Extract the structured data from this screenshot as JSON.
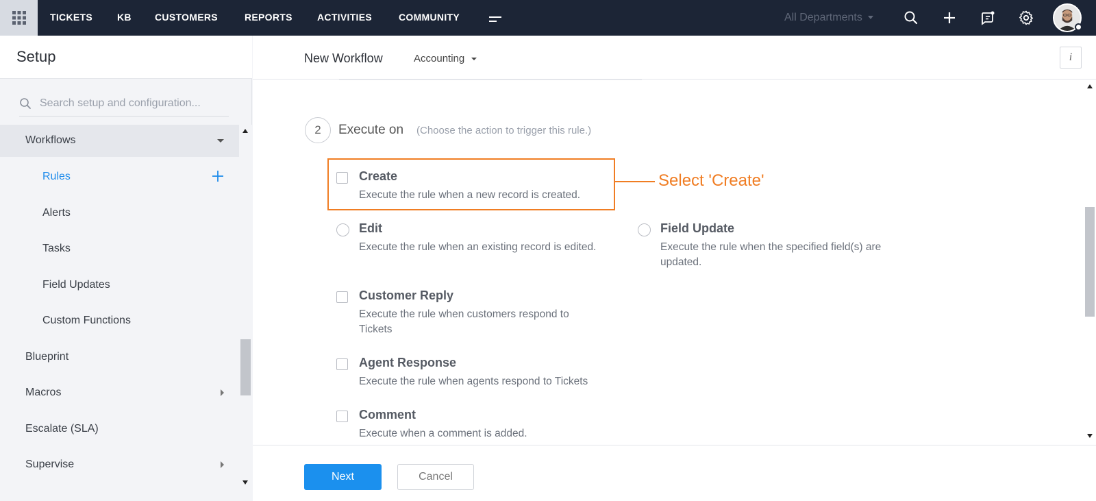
{
  "topnav": {
    "apps_icon": "grid-icon",
    "links": [
      "TICKETS",
      "KB",
      "CUSTOMERS",
      "REPORTS",
      "ACTIVITIES",
      "COMMUNITY"
    ],
    "more_icon": "menu-icon",
    "department": "All Departments",
    "icons": [
      "search-icon",
      "plus-icon",
      "chat-icon",
      "gear-icon"
    ]
  },
  "sidebar": {
    "title": "Setup",
    "search_placeholder": "Search setup and configuration...",
    "items": [
      {
        "label": "Workflows",
        "level": "top",
        "state": "expanded"
      },
      {
        "label": "Rules",
        "level": "sub",
        "state": "selected"
      },
      {
        "label": "Alerts",
        "level": "sub"
      },
      {
        "label": "Tasks",
        "level": "sub"
      },
      {
        "label": "Field Updates",
        "level": "sub"
      },
      {
        "label": "Custom Functions",
        "level": "sub"
      },
      {
        "label": "Blueprint",
        "level": "top"
      },
      {
        "label": "Macros",
        "level": "top",
        "state": "collapsed"
      },
      {
        "label": "Escalate (SLA)",
        "level": "top"
      },
      {
        "label": "Supervise",
        "level": "top",
        "state": "collapsed"
      }
    ]
  },
  "header": {
    "title": "New Workflow",
    "department": "Accounting",
    "info_label": "i"
  },
  "step": {
    "number": "2",
    "title": "Execute on",
    "hint": "(Choose the action to trigger this rule.)"
  },
  "options": {
    "create": {
      "title": "Create",
      "desc": "Execute the rule when a new record is created."
    },
    "edit": {
      "title": "Edit",
      "desc": "Execute the rule when an existing record is edited."
    },
    "field_update": {
      "title": "Field Update",
      "desc": "Execute the rule when the specified field(s) are updated."
    },
    "customer_reply": {
      "title": "Customer Reply",
      "desc": "Execute the rule when customers respond to Tickets"
    },
    "agent_response": {
      "title": "Agent Response",
      "desc": "Execute the rule when agents respond to Tickets"
    },
    "comment": {
      "title": "Comment",
      "desc": "Execute when a comment is added."
    }
  },
  "callout": {
    "text": "Select 'Create'",
    "color": "#f07d23"
  },
  "footer": {
    "next_label": "Next",
    "cancel_label": "Cancel"
  },
  "colors": {
    "topnav_bg": "#1c2536",
    "accent": "#1b90ee",
    "highlight": "#f07d23"
  }
}
